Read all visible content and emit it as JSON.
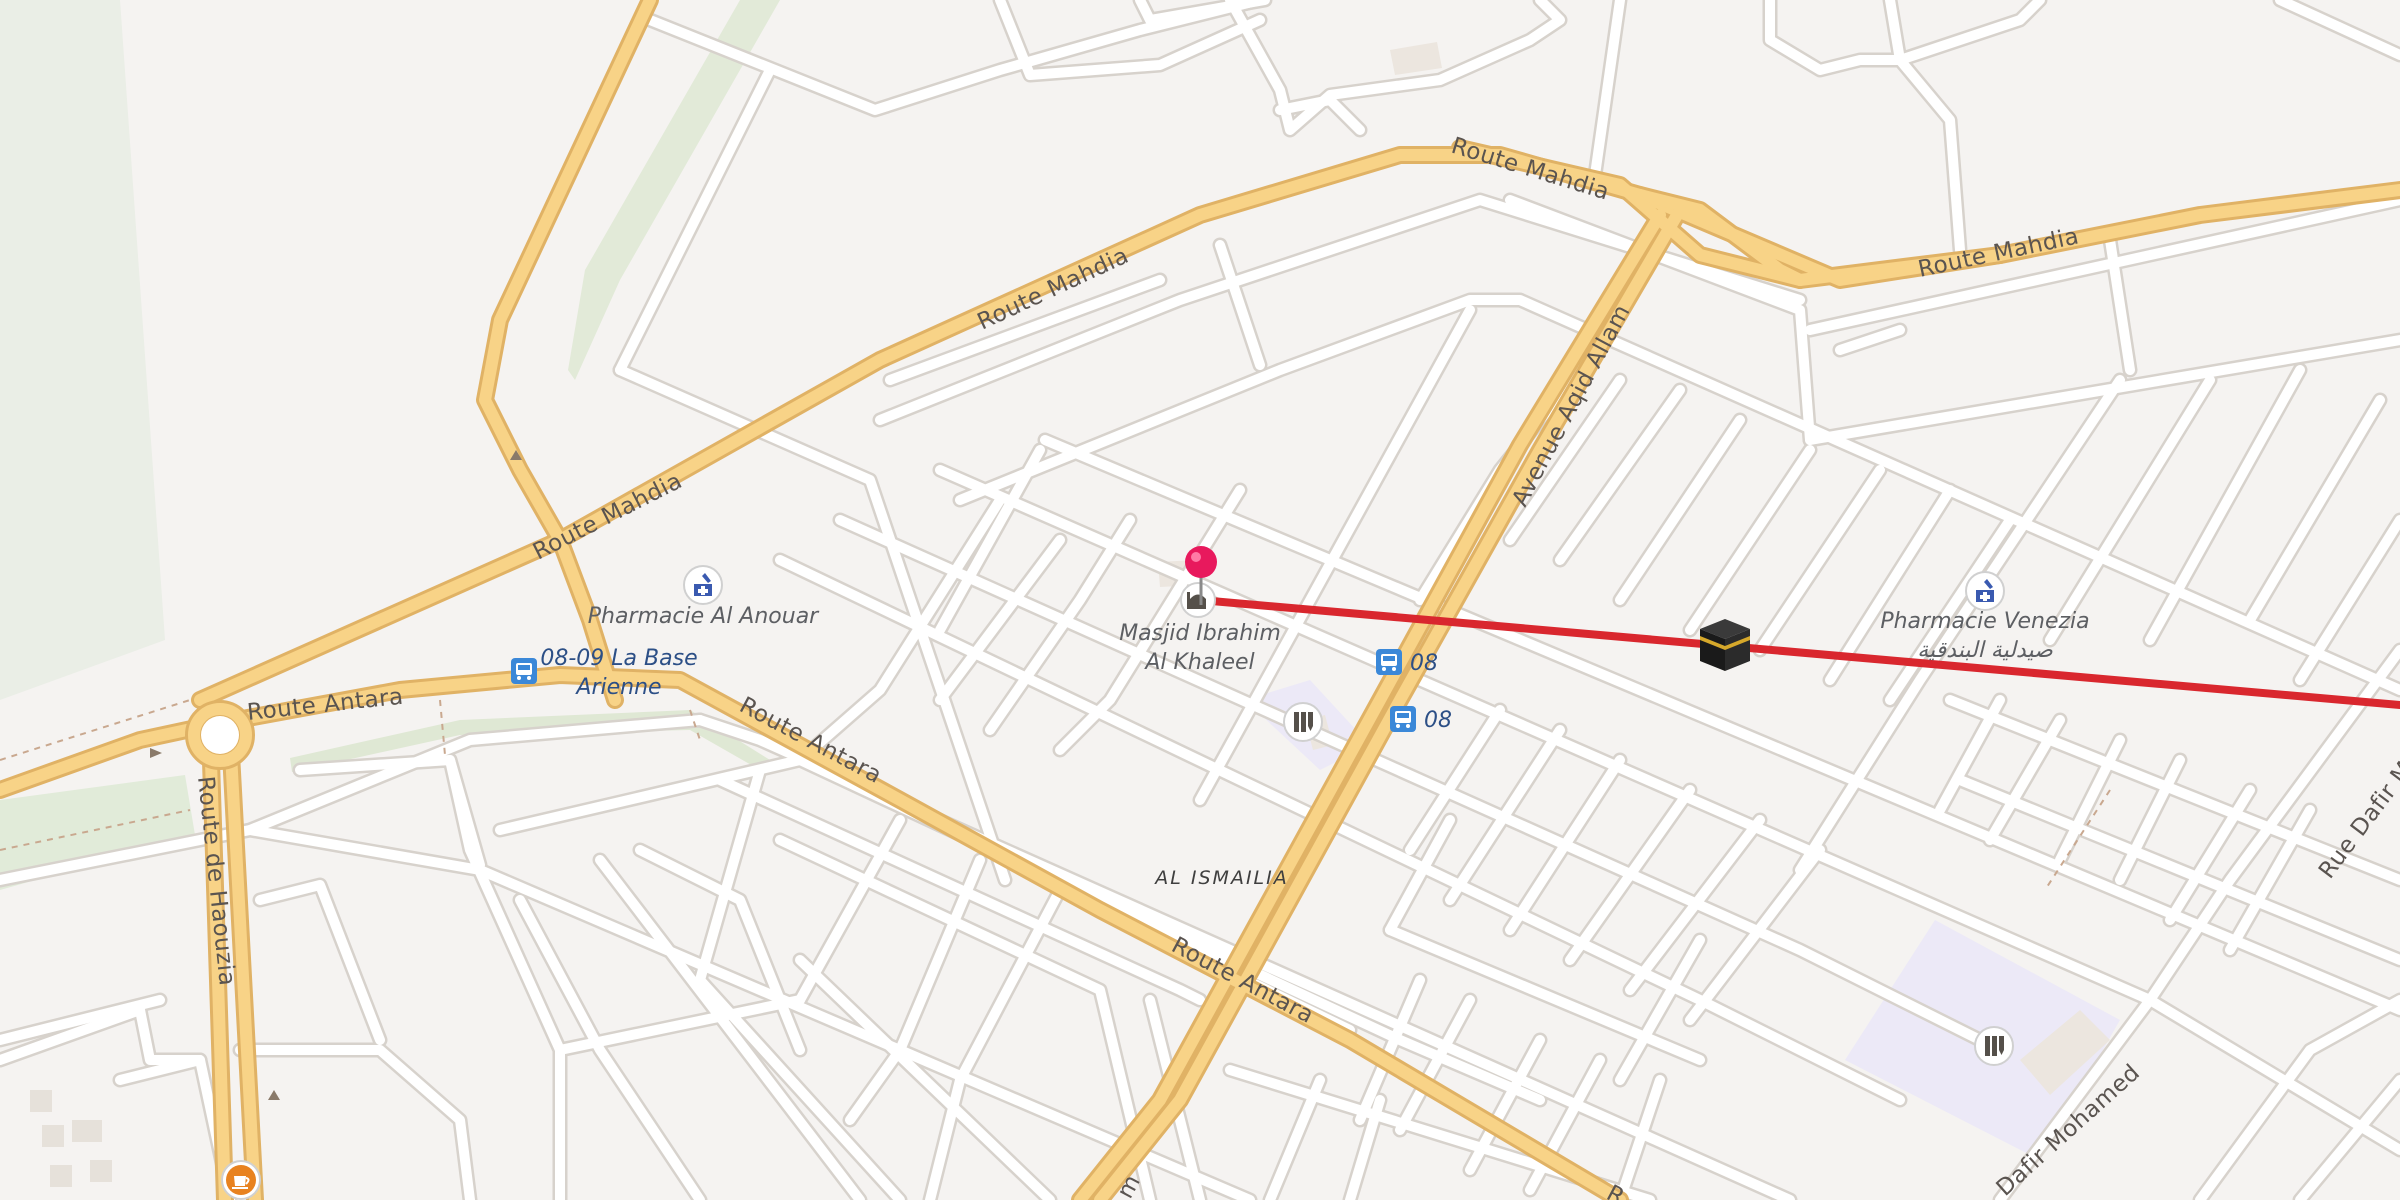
{
  "map": {
    "roads": {
      "route_mahdia": "Route Mahdia",
      "route_antara": "Route Antara",
      "route_de_haouzia": "Route de Haouzia",
      "avenue_aqid_allam": "Avenue Aqid Allam",
      "rue_dafir_mohamed": "Rue Dafir Mo",
      "dafir_mohamed": "Dafir Mohamed",
      "partial_bottom": "m",
      "partial_antara_end": "R"
    },
    "places": {
      "pharmacie_al_anouar": "Pharmacie Al Anouar",
      "pharmacie_venezia": "Pharmacie Venezia",
      "pharmacie_venezia_ar": "صيدلية البندقية",
      "masjid_line1": "Masjid Ibrahim",
      "masjid_line2": "Al Khaleel",
      "bus_base_line1": "08-09 La Base",
      "bus_base_line2": "Arienne",
      "bus_08_a": "08",
      "bus_08_b": "08",
      "neighbourhood": "AL ISMAILIA"
    },
    "icons": {
      "pharmacy": "pharmacy-icon",
      "bus": "bus-stop-icon",
      "mosque": "mosque-icon",
      "school": "school-icon",
      "kaaba": "kaaba-icon",
      "cafe": "cafe-icon",
      "pin": "location-pin-icon"
    },
    "colors": {
      "background": "#f5f3f1",
      "main_road": "#f5c97a",
      "minor_road": "#ffffff",
      "route_line": "#d9272e",
      "pin": "#e8195d",
      "green_area": "#e6eddf",
      "school_area": "#ece9f7"
    }
  }
}
